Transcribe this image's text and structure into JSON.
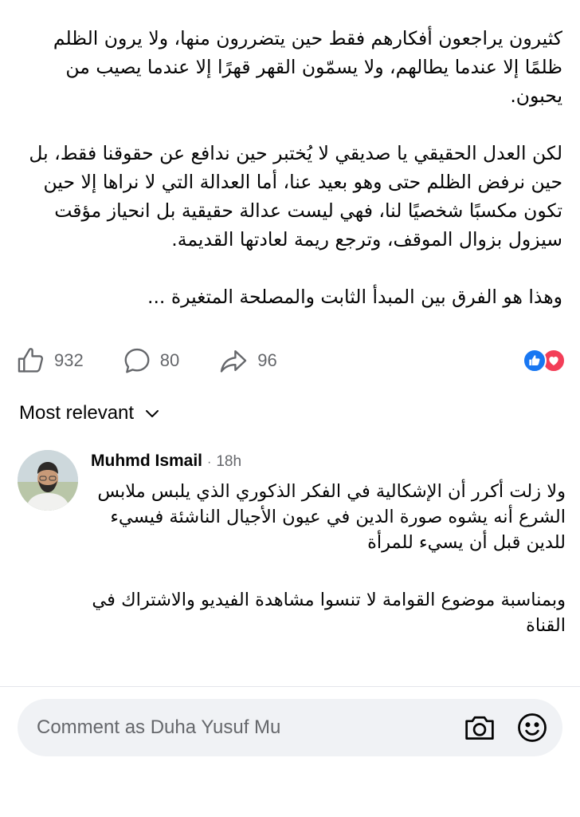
{
  "post": {
    "paragraphs": [
      "كثيرون يراجعون أفكارهم فقط حين يتضررون منها، ولا يرون الظلم ظلمًا إلا عندما يطالهم، ولا يسمّون القهر قهرًا إلا عندما يصيب من يحبون.",
      "لكن العدل الحقيقي يا صديقي لا يُختبر حين ندافع عن حقوقنا فقط، بل حين نرفض الظلم حتى وهو بعيد عنا، أما العدالة التي لا نراها إلا حين تكون مكسبًا شخصيًا لنا، فهي ليست عدالة حقيقية بل انحياز مؤقت سيزول بزوال الموقف، وترجع ريمة لعادتها القديمة.",
      "وهذا هو الفرق بين المبدأ الثابت والمصلحة المتغيرة ..."
    ]
  },
  "actions": {
    "like_count": "932",
    "comment_count": "80",
    "share_count": "96",
    "icons": [
      "thumbs-up-icon",
      "comment-bubble-icon",
      "share-arrow-icon",
      "like-reaction-icon",
      "love-reaction-icon"
    ]
  },
  "sort": {
    "label": "Most relevant",
    "icon": "chevron-down-icon"
  },
  "comment": {
    "author": "Muhmd Ismail",
    "separator": "·",
    "time": "18h",
    "paragraphs": [
      "ولا زلت أكرر أن الإشكالية في الفكر الذكوري الذي يلبس ملابس الشرع أنه يشوه صورة الدين في عيون الأجيال الناشئة فيسيء للدين قبل أن يسيء للمرأة",
      "وبمناسبة موضوع القوامة لا تنسوا مشاهدة الفيديو والاشتراك في القناة"
    ]
  },
  "composer": {
    "placeholder": "Comment as Duha Yusuf Mu",
    "icons": [
      "camera-icon",
      "emoji-icon"
    ]
  },
  "colors": {
    "text": "#050505",
    "secondary": "#65676b",
    "like_blue": "#1877f2",
    "love_red": "#f33e58",
    "composer_bg": "#f0f2f5"
  }
}
